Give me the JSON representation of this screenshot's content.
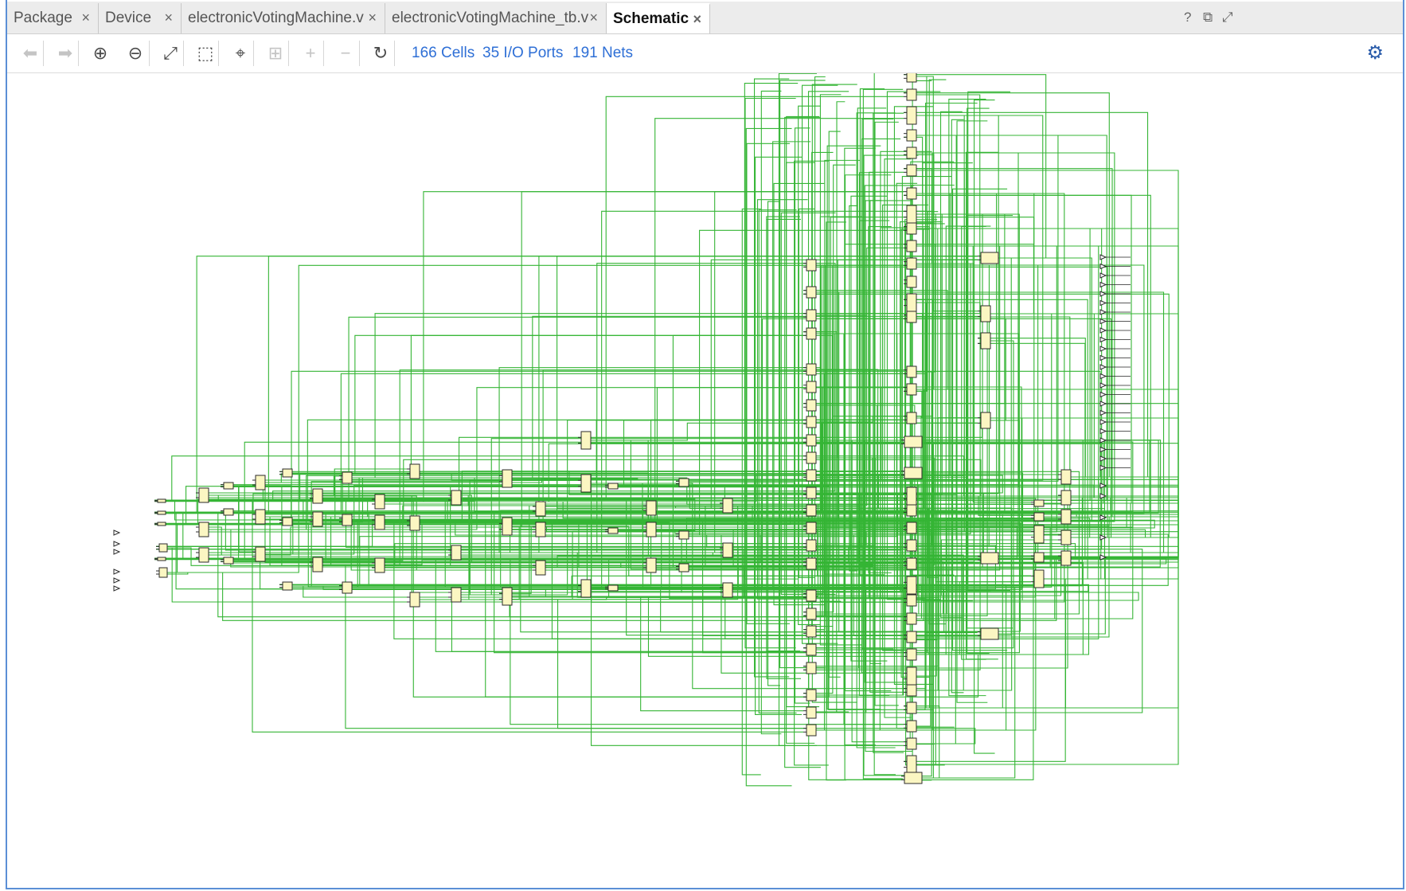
{
  "tabs": [
    {
      "label": "Package",
      "active": false
    },
    {
      "label": "Device",
      "active": false
    },
    {
      "label": "electronicVotingMachine.v",
      "active": false
    },
    {
      "label": "electronicVotingMachine_tb.v",
      "active": false
    },
    {
      "label": "Schematic",
      "active": true
    }
  ],
  "window_icons": {
    "help": "?",
    "restore": "⧉",
    "maximize": "⤢"
  },
  "toolbar": {
    "buttons": [
      {
        "name": "back-arrow-icon",
        "glyph": "⬅",
        "enabled": false
      },
      {
        "name": "forward-arrow-icon",
        "glyph": "➡",
        "enabled": false
      },
      {
        "name": "zoom-in-icon",
        "glyph": "⊕",
        "enabled": true
      },
      {
        "name": "zoom-out-icon",
        "glyph": "⊖",
        "enabled": true
      },
      {
        "name": "zoom-fit-icon",
        "glyph": "⤢",
        "enabled": true
      },
      {
        "name": "zoom-area-icon",
        "glyph": "⬚",
        "enabled": true
      },
      {
        "name": "crosshair-icon",
        "glyph": "⌖",
        "enabled": true
      },
      {
        "name": "expand-cell-icon",
        "glyph": "⊞",
        "enabled": false
      },
      {
        "name": "add-icon",
        "glyph": "+",
        "enabled": false
      },
      {
        "name": "remove-icon",
        "glyph": "−",
        "enabled": false
      },
      {
        "name": "refresh-icon",
        "glyph": "↻",
        "enabled": true
      }
    ],
    "stats": {
      "cells": "166 Cells",
      "io_ports": "35 I/O Ports",
      "nets": "191 Nets"
    },
    "settings_icon": "gear-icon"
  },
  "colors": {
    "wire": "#35b535",
    "cell_fill": "#fbf6c2",
    "cell_stroke": "#2b2b2b",
    "link": "#2e6fd6",
    "frame": "#5b8fd6"
  }
}
